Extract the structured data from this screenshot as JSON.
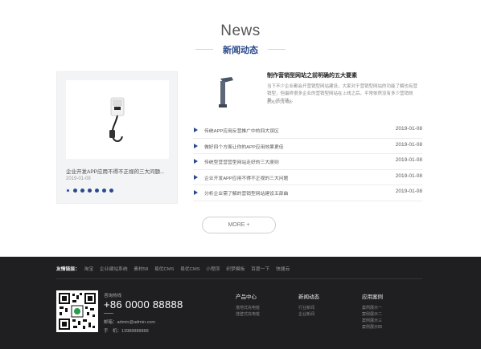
{
  "section": {
    "title": "News",
    "subtitle": "新闻动态"
  },
  "featured": {
    "title": "企业开发APP应用不得不正视的三大问题...",
    "date": "2019-01-08",
    "slide_count": 7,
    "active_slide": 0
  },
  "top_news": {
    "title": "制作营销型网站之前明确的五大要素",
    "desc": "当下不少企业都会开营销型网站建设，大家对于营销型网站的功能了解也有营销型，但最终很多企业的营销型网站在上线之后，平常依然没有多少营销效果，并不能...",
    "date": "2019-01-08"
  },
  "news_list": [
    {
      "title": "传统APP应用反营推广中的四大误区",
      "date": "2019-01-08"
    },
    {
      "title": "做好四个方面让你的APP应用效果更佳",
      "date": "2019-01-08"
    },
    {
      "title": "传统型营营营型网站走好的三大原则",
      "date": "2019-01-08"
    },
    {
      "title": "企业开发APP应用不得不正视的三大问题",
      "date": "2019-01-08"
    },
    {
      "title": "分析企业需了解的营销型网站建设五部曲",
      "date": "2019-01-08"
    }
  ],
  "more_button": {
    "label": "MORE +"
  },
  "footer": {
    "links_label": "友情链接：",
    "links": [
      "淘宝",
      "企业建站系统",
      "素材58",
      "易优CMS",
      "易优CMS",
      "小程序",
      "织梦模板",
      "百度一下",
      "快捷云"
    ],
    "contact": {
      "label": "咨询热线",
      "phone": "+86 0000 88888",
      "email": "邮箱：admin@admin.com",
      "mobile": "手　机：13988888888"
    },
    "columns": [
      {
        "heading": "产品中心",
        "items": [
          "落地式充电桩",
          "挂壁式充电桩"
        ]
      },
      {
        "heading": "新闻动态",
        "items": [
          "行业新闻",
          "企业新闻"
        ]
      },
      {
        "heading": "应用案例",
        "items": [
          "案例展示一",
          "案例展示二",
          "案例展示三",
          "案例展示四"
        ]
      }
    ]
  },
  "colors": {
    "accent": "#2a4a8c",
    "footer_bg": "#1f1f21"
  }
}
